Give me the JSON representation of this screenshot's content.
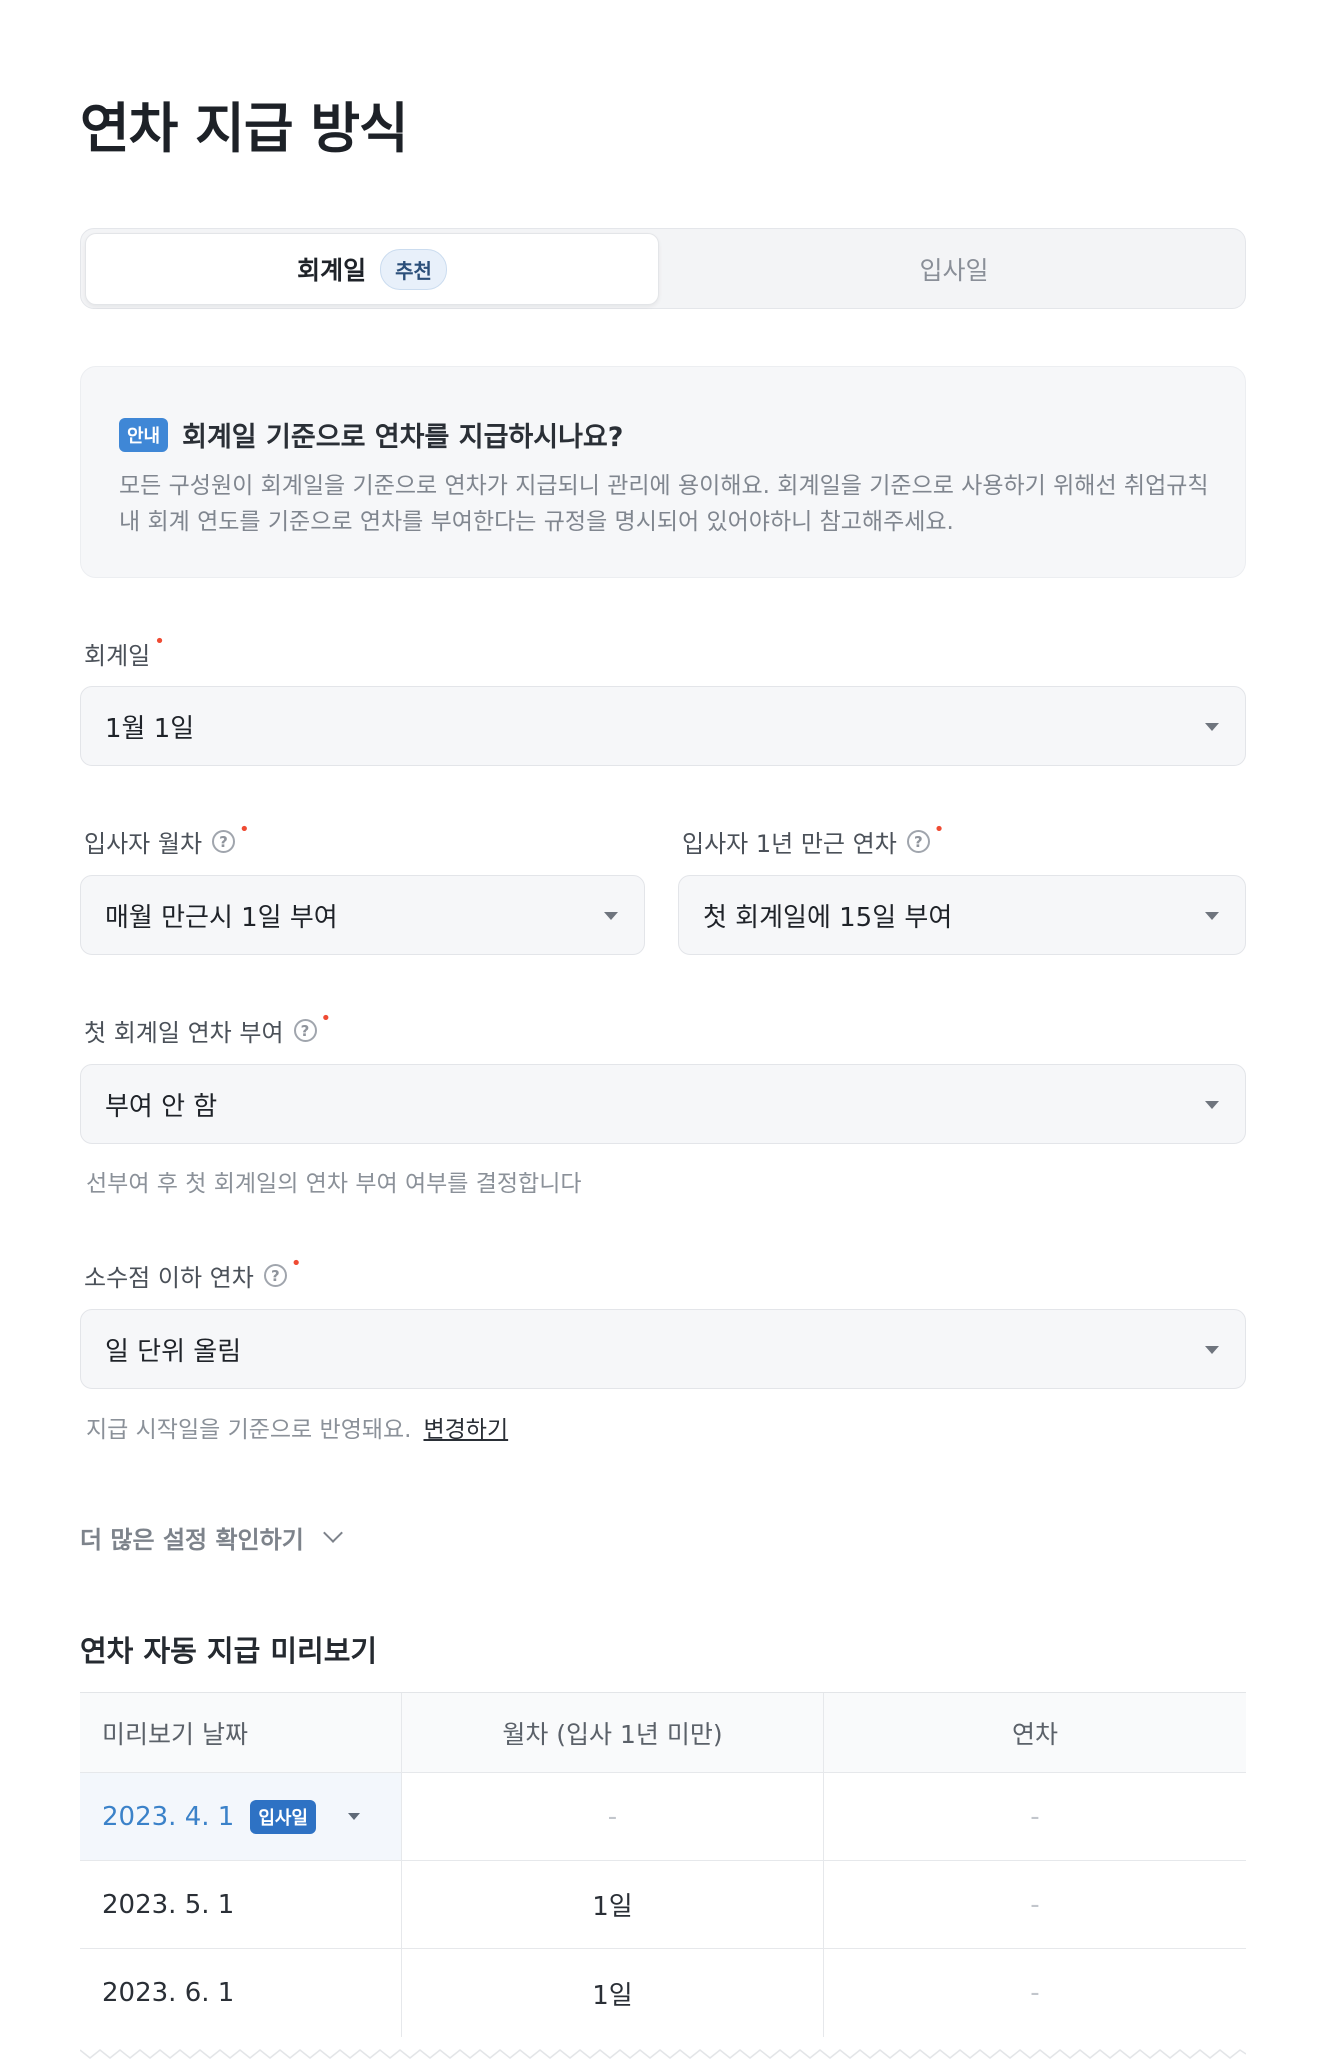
{
  "page": {
    "title": "연차 지급 방식"
  },
  "basis_tabs": {
    "options": [
      {
        "label": "회계일",
        "badge": "추천",
        "selected": true
      },
      {
        "label": "입사일",
        "selected": false
      }
    ]
  },
  "info": {
    "tag": "안내",
    "title": "회계일 기준으로 연차를 지급하시나요?",
    "body": "모든 구성원이 회계일을 기준으로 연차가 지급되니 관리에 용이해요. 회계일을 기준으로 사용하기 위해선 취업규칙 내 회계 연도를 기준으로 연차를 부여한다는 규정을 명시되어 있어야하니 참고해주세요."
  },
  "fields": {
    "accounting_date": {
      "label": "회계일",
      "value": "1월 1일"
    },
    "monthly_leave": {
      "label": "입사자 월차",
      "value": "매월 만근시 1일 부여"
    },
    "first_year_leave": {
      "label": "입사자 1년 만근 연차",
      "value": "첫 회계일에 15일 부여"
    },
    "first_accounting_grant": {
      "label": "첫 회계일 연차 부여",
      "value": "부여 안 함",
      "hint": "선부여 후 첫 회계일의 연차 부여 여부를 결정합니다"
    },
    "decimal_rounding": {
      "label": "소수점 이하 연차",
      "value": "일 단위 올림",
      "hint": "지급 시작일을 기준으로 반영돼요.",
      "hint_link": "변경하기"
    }
  },
  "more_settings": {
    "label": "더 많은 설정 확인하기"
  },
  "preview": {
    "title": "연차 자동 지급 미리보기",
    "columns": [
      "미리보기 날짜",
      "월차 (입사 1년 미만)",
      "연차"
    ],
    "rows": [
      {
        "date": "2023. 4. 1",
        "tag": "입사일",
        "monthly": "-",
        "annual": "-"
      },
      {
        "date": "2023. 5. 1",
        "monthly": "1일",
        "annual": "-"
      },
      {
        "date": "2023. 6. 1",
        "monthly": "1일",
        "annual": "-"
      }
    ]
  },
  "colors": {
    "accent": "#3f87d6",
    "required": "#ef4b33",
    "selected_date": "#3b82c9"
  }
}
